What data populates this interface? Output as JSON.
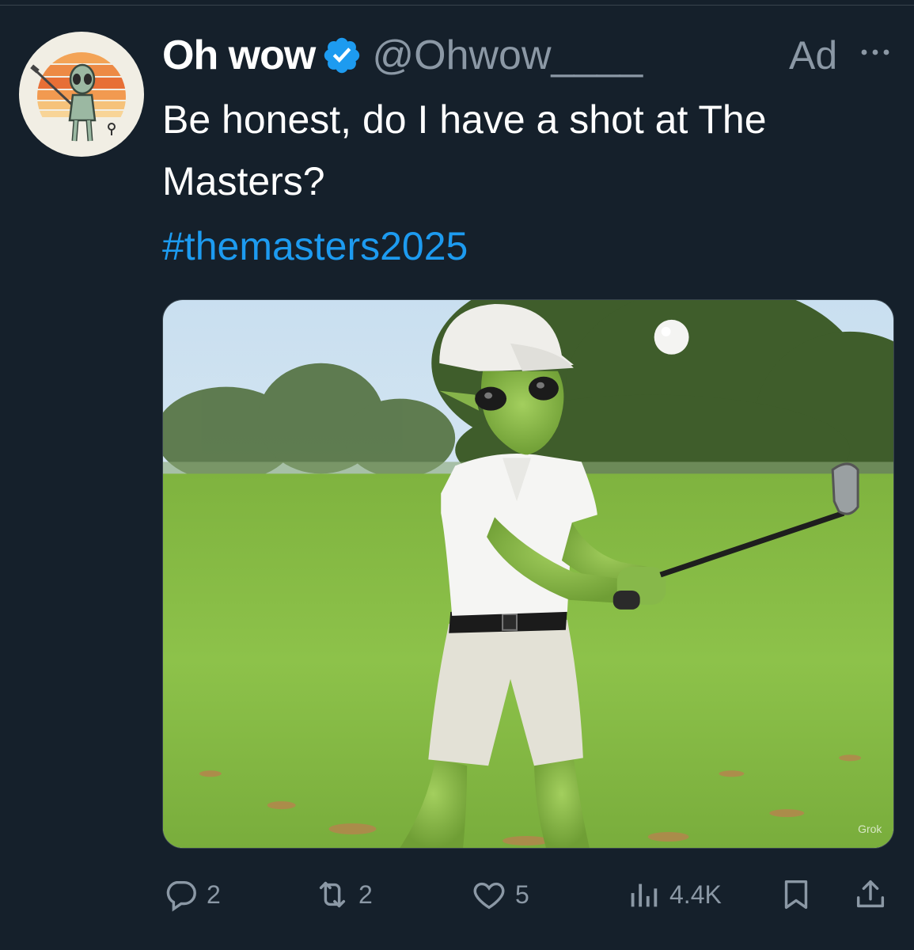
{
  "tweet": {
    "display_name": "Oh wow",
    "handle": "@Ohwow____",
    "ad_label": "Ad",
    "text": "Be honest, do I have a shot at The Masters?",
    "hashtag": "#themasters2025",
    "media_alt": "",
    "watermark": "Grok"
  },
  "actions": {
    "replies": "2",
    "reposts": "2",
    "likes": "5",
    "views": "4.4K"
  },
  "icons": {
    "verified": "verified-badge-icon",
    "more": "more-icon",
    "reply": "reply-icon",
    "repost": "repost-icon",
    "like": "heart-icon",
    "views": "views-icon",
    "bookmark": "bookmark-icon",
    "share": "share-icon"
  },
  "colors": {
    "background": "#15202b",
    "secondary_text": "#8b98a5",
    "accent": "#1d9bf0"
  }
}
